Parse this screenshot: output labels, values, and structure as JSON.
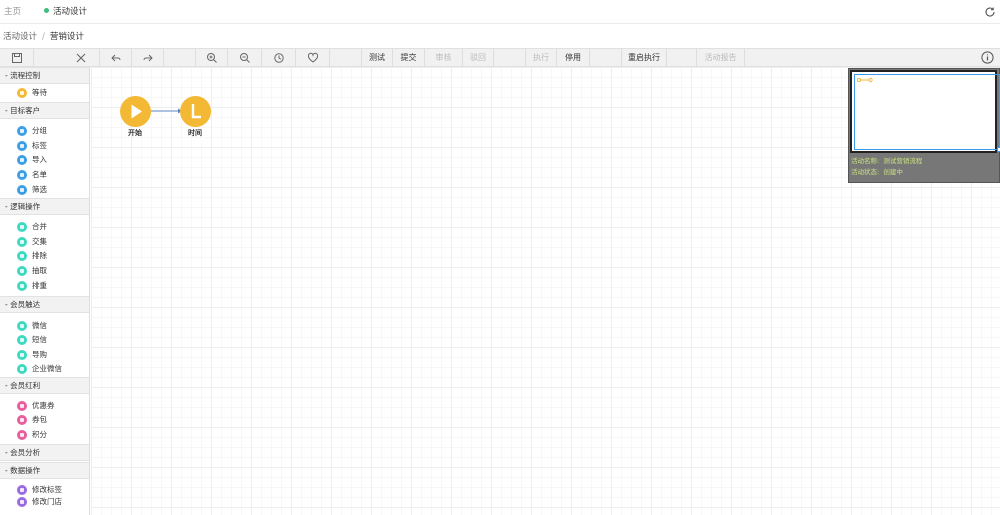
{
  "tabs": {
    "home": "主页",
    "active": "活动设计"
  },
  "breadcrumb": {
    "parent": "活动设计",
    "separator": "/",
    "current": "营销设计"
  },
  "toolbar": {
    "buttons": {
      "test": "测试",
      "submit": "提交",
      "review": "审核",
      "reject": "驳回",
      "execute": "执行",
      "disable": "停用",
      "restart": "重启执行",
      "report": "活动报告"
    },
    "icons": [
      "save-icon",
      "close-icon",
      "undo-icon",
      "redo-icon",
      "zoom-in-icon",
      "zoom-out-icon",
      "history-icon",
      "favorite-icon",
      "info-icon"
    ]
  },
  "sidebar": {
    "sections": [
      {
        "title": "- 流程控制",
        "items": [
          {
            "label": "等待",
            "color": "#f3b935"
          }
        ]
      },
      {
        "title": "- 目标客户",
        "items": [
          {
            "label": "分组",
            "color": "#3d9ee8"
          },
          {
            "label": "标签",
            "color": "#3d9ee8"
          },
          {
            "label": "导入",
            "color": "#3d9ee8"
          },
          {
            "label": "名单",
            "color": "#3d9ee8"
          },
          {
            "label": "筛选",
            "color": "#3d9ee8"
          }
        ]
      },
      {
        "title": "- 逻辑操作",
        "items": [
          {
            "label": "合并",
            "color": "#3fd9c1"
          },
          {
            "label": "交集",
            "color": "#3fd9c1"
          },
          {
            "label": "排除",
            "color": "#3fd9c1"
          },
          {
            "label": "抽取",
            "color": "#3fd9c1"
          },
          {
            "label": "排重",
            "color": "#3fd9c1"
          }
        ]
      },
      {
        "title": "- 会员触达",
        "items": [
          {
            "label": "微信",
            "color": "#3fd9c1"
          },
          {
            "label": "短信",
            "color": "#3fd9c1"
          },
          {
            "label": "导购",
            "color": "#3fd9c1"
          },
          {
            "label": "企业微信",
            "color": "#3fd9c1"
          }
        ]
      },
      {
        "title": "- 会员红利",
        "items": [
          {
            "label": "优惠券",
            "color": "#e85d9b"
          },
          {
            "label": "券包",
            "color": "#e85d9b"
          },
          {
            "label": "积分",
            "color": "#e85d9b"
          }
        ]
      },
      {
        "title": "- 会员分析",
        "items": []
      },
      {
        "title": "- 数据操作",
        "items": [
          {
            "label": "修改标签",
            "color": "#9b6ae0"
          },
          {
            "label": "修改门店",
            "color": "#9b6ae0"
          }
        ]
      }
    ]
  },
  "canvas": {
    "nodes": {
      "start": "开始",
      "time": "时间"
    },
    "node_color": "#f3b935"
  },
  "minimap": {
    "name_label": "活动名称:",
    "name_value": "测试营销流程",
    "status_label": "活动状态:",
    "status_value": "创建中"
  }
}
